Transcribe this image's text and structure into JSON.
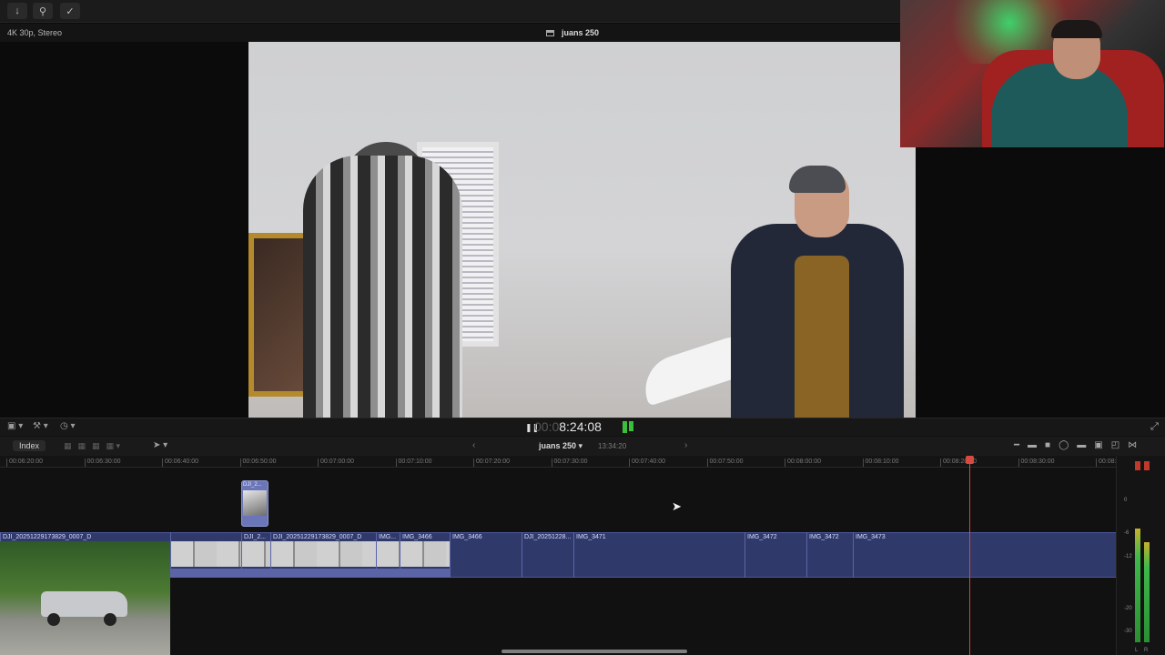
{
  "toolbar": {
    "import_icon": "download-arrow-icon",
    "keywords_icon": "key-icon",
    "background_tasks_icon": "checkmark-circle-icon"
  },
  "viewer": {
    "format": "4K 30p, Stereo",
    "project_title": "juans 250",
    "timecode_dim": "00:0",
    "timecode": "8:24:08"
  },
  "timeline": {
    "index_label": "Index",
    "project_name": "juans 250",
    "project_duration": "13:34:20",
    "ruler_ticks": [
      "00:06:20:00",
      "00:06:30:00",
      "00:06:40:00",
      "00:06:50:00",
      "00:07:00:00",
      "00:07:10:00",
      "00:07:20:00",
      "00:07:30:00",
      "00:07:40:00",
      "00:07:50:00",
      "00:08:00:00",
      "00:08:10:00",
      "00:08:20:00",
      "00:08:30:00",
      "00:08:"
    ],
    "connected_clip": {
      "name": "DJI_2..."
    },
    "clips": [
      {
        "name": "DJI_20251229173829_0007_D"
      },
      {
        "name": ""
      },
      {
        "name": "DJI_2..."
      },
      {
        "name": "DJI_20251229173829_0007_D"
      },
      {
        "name": "IMG..."
      },
      {
        "name": "IMG_3466"
      },
      {
        "name": "IMG_3466"
      },
      {
        "name": "DJI_20251228..."
      },
      {
        "name": "IMG_3471"
      },
      {
        "name": "IMG_3472"
      },
      {
        "name": "IMG_3472"
      },
      {
        "name": "IMG_3473"
      }
    ]
  },
  "meters": {
    "scale": [
      "0",
      "-6",
      "-12",
      "-20",
      "-30"
    ],
    "left_label": "L",
    "right_label": "R",
    "left_level": 0.66,
    "right_level": 0.58
  },
  "colors": {
    "playhead": "#e0433a",
    "primary_storyline": "#303a6a",
    "meter_green": "#3fb84a"
  }
}
